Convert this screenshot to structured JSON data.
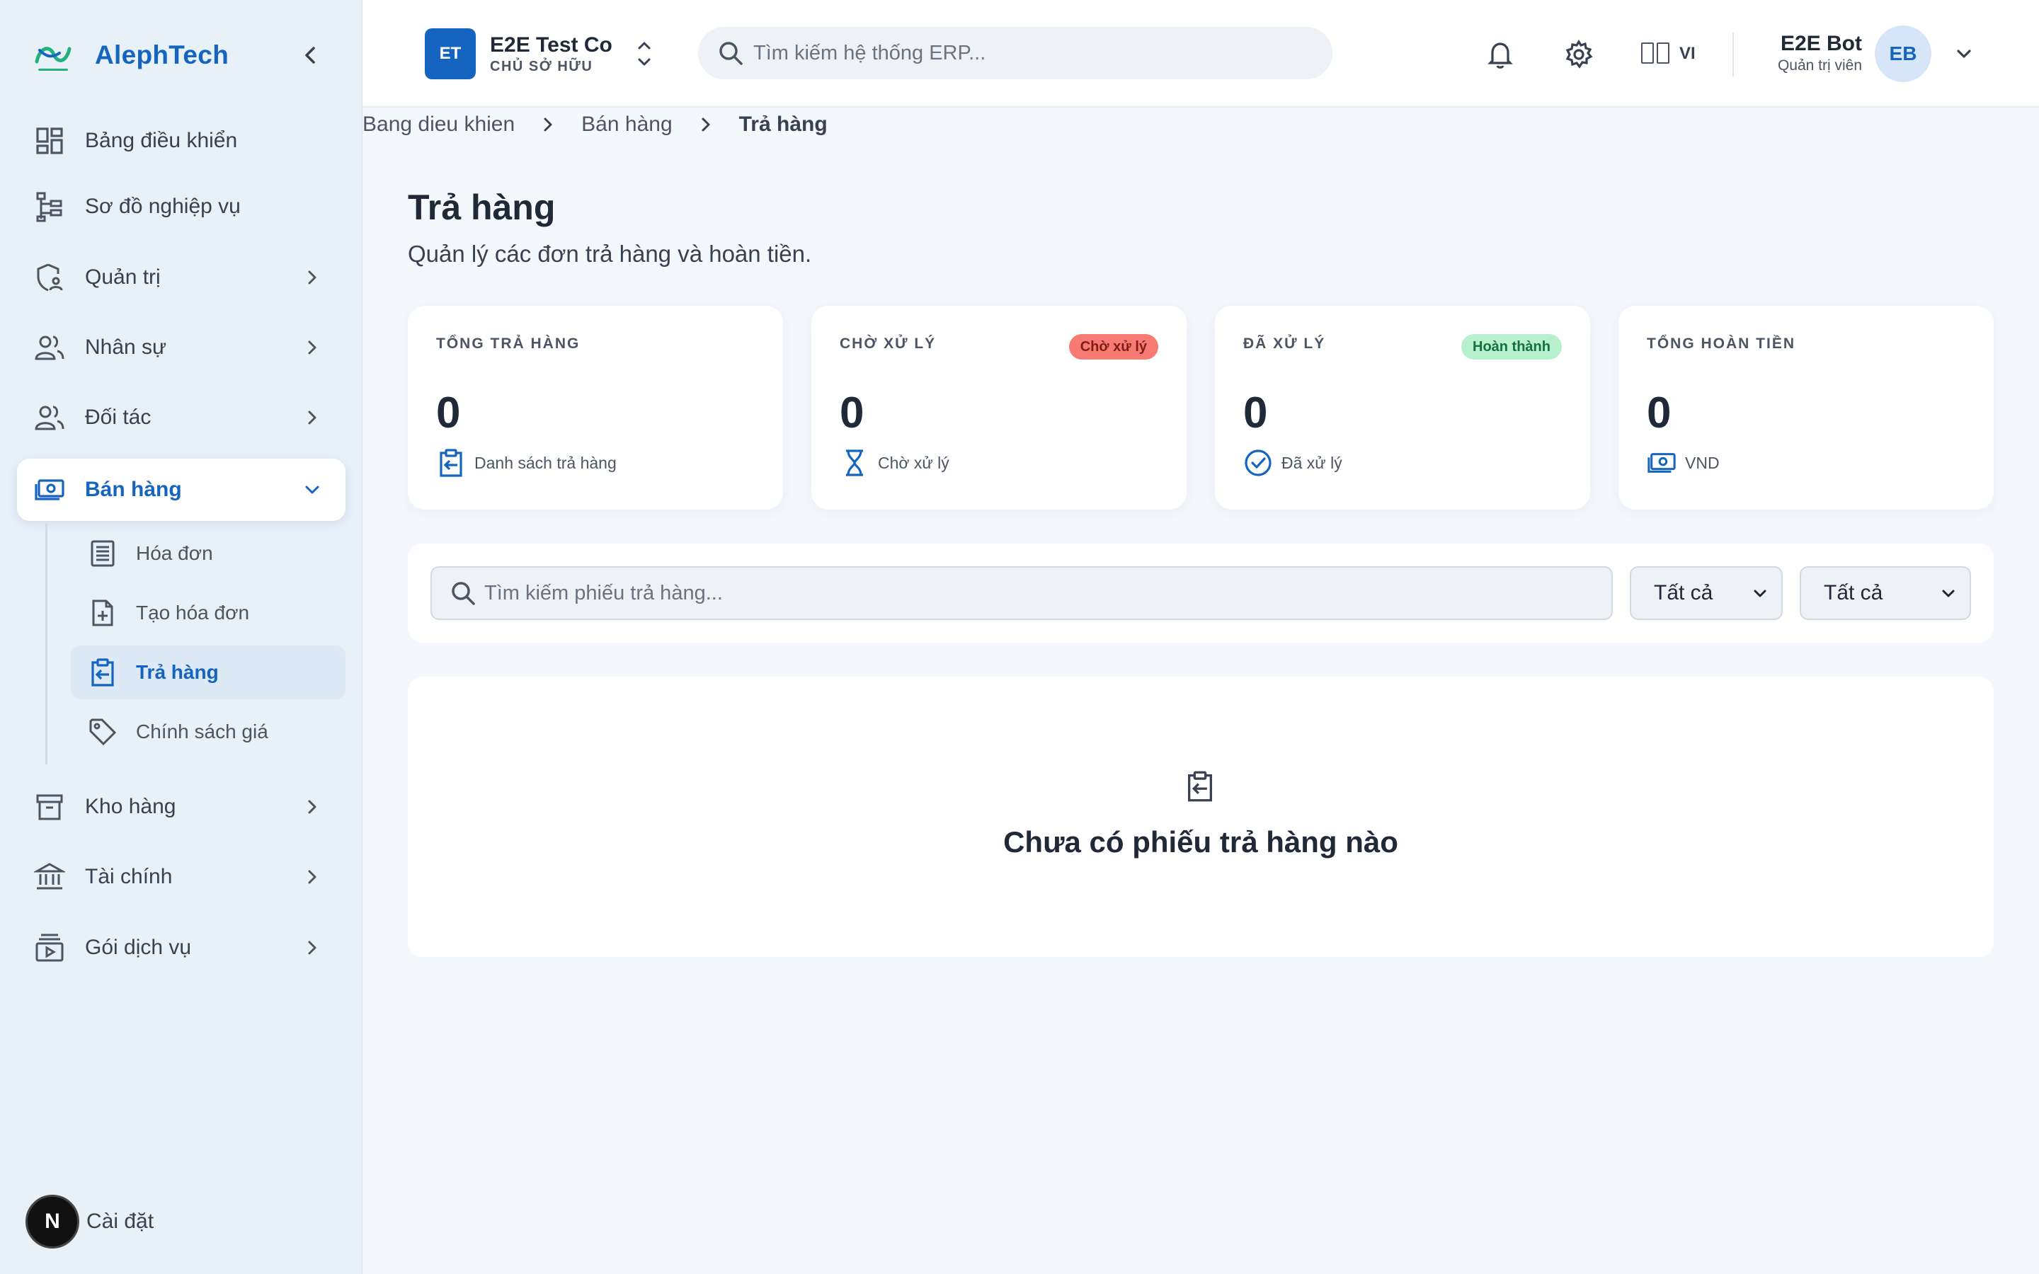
{
  "brand": {
    "name": "AlephTech"
  },
  "sidebar": {
    "items": [
      {
        "label": "Bảng điều khiển"
      },
      {
        "label": "Sơ đồ nghiệp vụ"
      },
      {
        "label": "Quản trị"
      },
      {
        "label": "Nhân sự"
      },
      {
        "label": "Đối tác"
      },
      {
        "label": "Bán hàng"
      },
      {
        "label": "Kho hàng"
      },
      {
        "label": "Tài chính"
      },
      {
        "label": "Gói dịch vụ"
      }
    ],
    "sub_items": [
      {
        "label": "Hóa đơn"
      },
      {
        "label": "Tạo hóa đơn"
      },
      {
        "label": "Trả hàng"
      },
      {
        "label": "Chính sách giá"
      }
    ],
    "footer": {
      "badge": "N",
      "label": "Cài đặt"
    }
  },
  "header": {
    "company": {
      "initials": "ET",
      "name": "E2E Test Co",
      "role": "CHỦ SỞ HỮU"
    },
    "search": {
      "placeholder": "Tìm kiếm hệ thống ERP..."
    },
    "language": "VI",
    "user": {
      "name": "E2E Bot",
      "role": "Quản trị viên",
      "initials": "EB"
    }
  },
  "breadcrumb": [
    "Bang dieu khien",
    "Bán hàng",
    "Trả hàng"
  ],
  "page": {
    "title": "Trả hàng",
    "subtitle": "Quản lý các đơn trả hàng và hoàn tiền."
  },
  "stats": [
    {
      "label": "TỔNG TRẢ HÀNG",
      "value": "0",
      "foot": "Danh sách trả hàng",
      "badge": ""
    },
    {
      "label": "CHỜ XỬ LÝ",
      "value": "0",
      "foot": "Chờ xử lý",
      "badge": "Chờ xử lý"
    },
    {
      "label": "ĐÃ XỬ LÝ",
      "value": "0",
      "foot": "Đã xử lý",
      "badge": "Hoàn thành"
    },
    {
      "label": "TỔNG HOÀN TIỀN",
      "value": "0",
      "foot": "VND",
      "badge": ""
    }
  ],
  "filters": {
    "search_placeholder": "Tìm kiếm phiếu trả hàng...",
    "status_select": "Tất cả",
    "type_select": "Tất cả"
  },
  "empty_state": {
    "message": "Chưa có phiếu trả hàng nào"
  },
  "colors": {
    "accent": "#1565c0",
    "sidebar_bg": "#e8f0f8",
    "page_bg": "#f4f8fc",
    "badge_pending": "#f77b72",
    "badge_done": "#b7f0cc"
  }
}
